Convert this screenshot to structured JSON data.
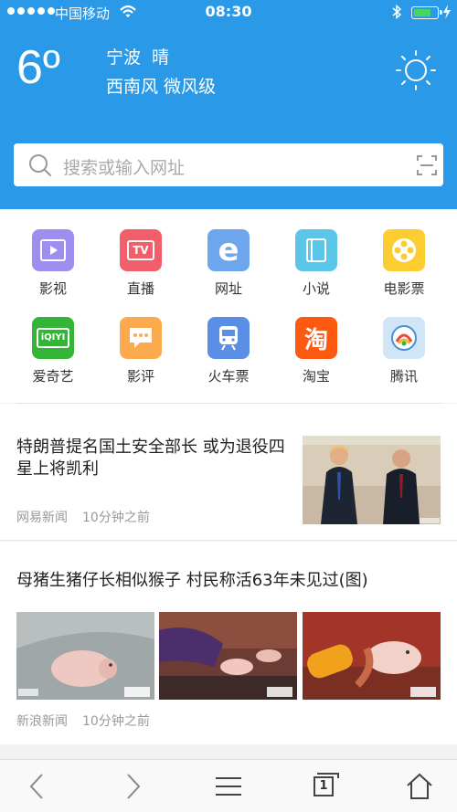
{
  "status_bar": {
    "carrier": "中国移动",
    "time": "08:30"
  },
  "weather": {
    "temperature": "6º",
    "city": "宁波",
    "condition": "晴",
    "wind_dir": "西南风",
    "wind_level": "微风级"
  },
  "search": {
    "placeholder": "搜索或输入网址"
  },
  "shortcuts": [
    {
      "label": "影视",
      "icon": "video-icon",
      "color": "#9c8ff0"
    },
    {
      "label": "直播",
      "icon": "tv-icon",
      "color": "#f25e6a",
      "text": "TV"
    },
    {
      "label": "网址",
      "icon": "browser-e-icon",
      "color": "#6ea6ee",
      "text": "e"
    },
    {
      "label": "小说",
      "icon": "book-icon",
      "color": "#5cc6ea"
    },
    {
      "label": "电影票",
      "icon": "film-reel-icon",
      "color": "#fccc31"
    },
    {
      "label": "爱奇艺",
      "icon": "iqiyi-icon",
      "color": "#35b538",
      "text": "iQIYI"
    },
    {
      "label": "影评",
      "icon": "comment-icon",
      "color": "#fbaa4e"
    },
    {
      "label": "火车票",
      "icon": "train-icon",
      "color": "#5b8fe6"
    },
    {
      "label": "淘宝",
      "icon": "taobao-icon",
      "color": "#fb5a10",
      "text": "淘"
    },
    {
      "label": "腾讯",
      "icon": "tencent-news-icon",
      "color": "#d0e6f7"
    }
  ],
  "news": [
    {
      "title": "特朗普提名国土安全部长 或为退役四星上将凯利",
      "source": "网易新闻",
      "time": "10分钟之前"
    },
    {
      "title": "母猪生猪仔长相似猴子 村民称活63年未见过(图)",
      "source": "新浪新闻",
      "time": "10分钟之前"
    }
  ],
  "toolbar": {
    "tab_count": "1",
    "icons": [
      "back-icon",
      "forward-icon",
      "menu-icon",
      "tabs-icon",
      "home-icon"
    ]
  },
  "colors": {
    "header": "#2a9ae8",
    "battery": "#44d862"
  }
}
